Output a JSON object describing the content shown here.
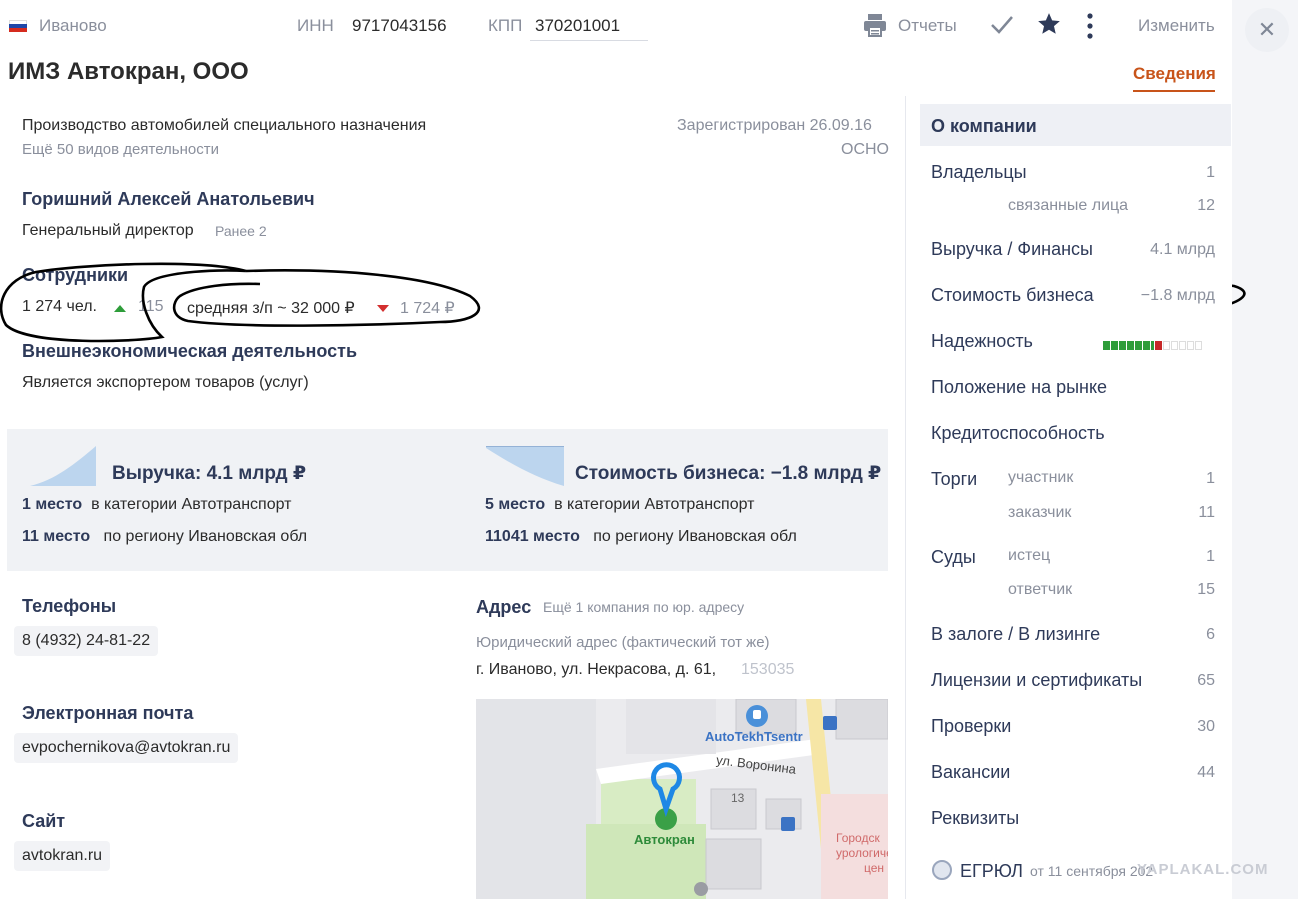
{
  "header": {
    "city": "Иваново",
    "inn_label": "ИНН",
    "inn_value": "9717043156",
    "kpp_label": "КПП",
    "kpp_value": "370201001",
    "reports_label": "Отчеты",
    "edit_label": "Изменить",
    "company_name": "ИМЗ Автокран, ООО",
    "tab_info": "Сведения"
  },
  "overview": {
    "activity": "Производство автомобилей специального назначения",
    "activity_more": "Ещё 50 видов деятельности",
    "registered": "Зарегистрирован 26.09.16",
    "tax_regime": "ОСНО",
    "director_name": "Горишний Алексей Анатольевич",
    "director_role": "Генеральный директор",
    "director_earlier": "Ранее 2",
    "employees_heading": "Сотрудники",
    "employees_count": "1 274 чел.",
    "employees_delta": "115",
    "avg_salary": "средняя з/п ~ 32 000 ₽",
    "salary_delta": "1 724 ₽",
    "foreign_heading": "Внешнеэкономическая деятельность",
    "foreign_text": "Является экспортером товаров (услуг)"
  },
  "stats": {
    "revenue_title": "Выручка: 4.1 млрд ₽",
    "revenue_cat_place": "1 место",
    "revenue_cat_text": "в категории Автотранспорт",
    "revenue_reg_place": "11 место",
    "revenue_reg_text": "по региону Ивановская обл",
    "value_title": "Стоимость бизнеса: −1.8 млрд ₽",
    "value_cat_place": "5 место",
    "value_cat_text": "в категории Автотранспорт",
    "value_reg_place": "11041 место",
    "value_reg_text": "по региону Ивановская обл"
  },
  "contacts": {
    "phones_heading": "Телефоны",
    "phone": "8 (4932) 24-81-22",
    "email_heading": "Электронная почта",
    "email": "evpochernikova@avtokran.ru",
    "site_heading": "Сайт",
    "site": "avtokran.ru",
    "address_heading": "Адрес",
    "address_more": "Ещё 1 компания по юр. адресу",
    "address_type": "Юридический адрес (фактический тот же)",
    "address": "г. Иваново, ул. Некрасова, д. 61,",
    "postcode": "153035"
  },
  "map": {
    "poi1": "AutoTekhTsentr",
    "street": "ул. Воронина",
    "house": "13",
    "marker_label": "Автокран",
    "poi2_line1": "Городск",
    "poi2_line2": "урологическ",
    "poi2_line3": "цен"
  },
  "sidebar": {
    "about": "О компании",
    "owners": "Владельцы",
    "owners_n": "1",
    "related": "связанные лица",
    "related_n": "12",
    "revenue": "Выручка / Финансы",
    "revenue_n": "4.1 млрд",
    "value": "Стоимость бизнеса",
    "value_n": "−1.8 млрд",
    "reliability": "Надежность",
    "market": "Положение на рынке",
    "credit": "Кредитоспособность",
    "tenders": "Торги",
    "participant": "участник",
    "participant_n": "1",
    "customer": "заказчик",
    "customer_n": "11",
    "courts": "Суды",
    "plaintiff": "истец",
    "plaintiff_n": "1",
    "defendant": "ответчик",
    "defendant_n": "15",
    "pledge": "В залоге / В лизинге",
    "pledge_n": "6",
    "licenses": "Лицензии и сертификаты",
    "licenses_n": "65",
    "inspections": "Проверки",
    "inspections_n": "30",
    "vacancies": "Вакансии",
    "vacancies_n": "44",
    "requisites": "Реквизиты",
    "egrul": "ЕГРЮЛ",
    "egrul_date": "от 11 сентября 202",
    "watermark": "YAPLAKAL.COM"
  },
  "colors": {
    "accent": "#c8541a",
    "navy": "#2e3a59",
    "good": "#2e9d3a",
    "bad": "#d32f2f"
  }
}
